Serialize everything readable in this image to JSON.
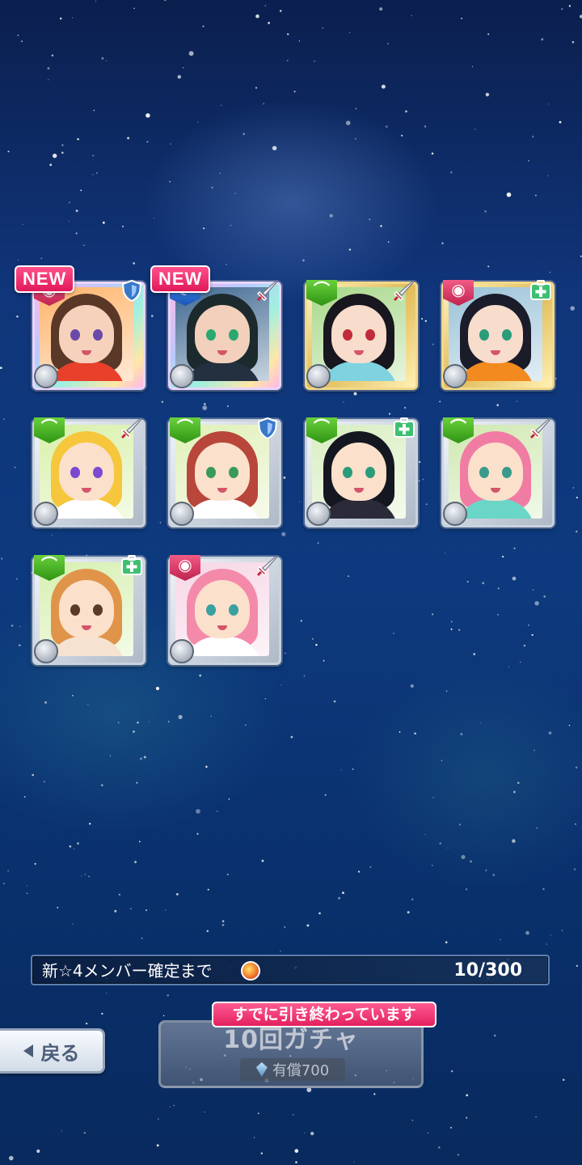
{
  "colors": {
    "accent_pink": "#e2205e",
    "new_tag": "#ff4f8a"
  },
  "cards": [
    {
      "new": true,
      "attribute": "pink",
      "role_icon": "shield-icon",
      "weapon_icon": "dagger-icon",
      "rarity": "rainbow",
      "hair": "#5a3828",
      "skin": "#f6d2bc",
      "eye": "#6a4aa8",
      "outfit": "#e8402a",
      "bg": "#ffb36b"
    },
    {
      "new": true,
      "attribute": "blue",
      "role_icon": "sword-icon",
      "weapon_icon": "dagger-icon",
      "rarity": "rainbow",
      "hair": "#1c2a2e",
      "skin": "#f2d0bc",
      "eye": "#2aa870",
      "outfit": "#223040",
      "bg": "#406890"
    },
    {
      "new": false,
      "attribute": "green",
      "role_icon": "sword-icon",
      "weapon_icon": "whip-icon",
      "rarity": "gold",
      "hair": "#18161e",
      "skin": "#f8dccc",
      "eye": "#c02a3a",
      "outfit": "#7fd3e0",
      "bg": "#a8d88a"
    },
    {
      "new": false,
      "attribute": "pink",
      "role_icon": "heal-icon",
      "weapon_icon": "gun-icon",
      "rarity": "gold",
      "hair": "#1a1c2a",
      "skin": "#f8dccc",
      "eye": "#2a9c7a",
      "outfit": "#f28a20",
      "bg": "#9ac2d8"
    },
    {
      "new": false,
      "attribute": "green",
      "role_icon": "sword-icon",
      "weapon_icon": "dagger-icon",
      "rarity": "silver",
      "hair": "#f6c63c",
      "skin": "#fbe0cc",
      "eye": "#7a4ad0",
      "outfit": "#ffffff",
      "bg": "#d8f0a8"
    },
    {
      "new": false,
      "attribute": "green",
      "role_icon": "shield-icon",
      "weapon_icon": "dagger-icon",
      "rarity": "silver",
      "hair": "#b8463a",
      "skin": "#fbe0cc",
      "eye": "#3a9a5a",
      "outfit": "#ffffff",
      "bg": "#e0f0b8"
    },
    {
      "new": false,
      "attribute": "green",
      "role_icon": "heal-icon",
      "weapon_icon": "gun-icon",
      "rarity": "silver",
      "hair": "#141620",
      "skin": "#fbe0cc",
      "eye": "#2a9c7a",
      "outfit": "#2a2a38",
      "bg": "#d8eec0"
    },
    {
      "new": false,
      "attribute": "green",
      "role_icon": "sword-icon",
      "weapon_icon": "hammer-icon",
      "rarity": "silver",
      "hair": "#f07ca4",
      "skin": "#fbe0cc",
      "eye": "#3a9a8a",
      "outfit": "#6ad6c8",
      "bg": "#cfe8b0"
    },
    {
      "new": false,
      "attribute": "green",
      "role_icon": "heal-icon",
      "weapon_icon": "hammer-icon",
      "rarity": "silver",
      "hair": "#e0944a",
      "skin": "#fbe0cc",
      "eye": "#5a3a28",
      "outfit": "#f6e2d0",
      "bg": "#d6f0b0"
    },
    {
      "new": false,
      "attribute": "pink",
      "role_icon": "sword-icon",
      "weapon_icon": "hammer-icon",
      "rarity": "silver",
      "hair": "#f48aaa",
      "skin": "#fbe0cc",
      "eye": "#3aa0a0",
      "outfit": "#ffffff",
      "bg": "#f6d6e6"
    }
  ],
  "new_label": "NEW",
  "progress": {
    "label": "新☆4メンバー確定まで",
    "count": "10/300"
  },
  "back_button": {
    "label": "戻る"
  },
  "gacha_button": {
    "title": "10回ガチャ",
    "cost": "有償700",
    "status_tag": "すでに引き終わっています"
  }
}
